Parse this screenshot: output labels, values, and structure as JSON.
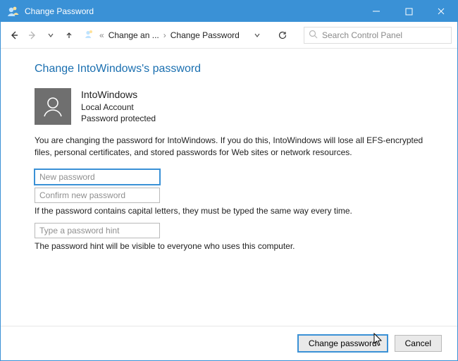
{
  "window": {
    "title": "Change Password"
  },
  "breadcrumb": {
    "seg1": "Change an ...",
    "seg2": "Change Password"
  },
  "search": {
    "placeholder": "Search Control Panel"
  },
  "heading": "Change IntoWindows's password",
  "account": {
    "name": "IntoWindows",
    "type": "Local Account",
    "status": "Password protected"
  },
  "warning": "You are changing the password for IntoWindows.  If you do this, IntoWindows will lose all EFS-encrypted files, personal certificates, and stored passwords for Web sites or network resources.",
  "fields": {
    "new_pw_placeholder": "New password",
    "confirm_pw_placeholder": "Confirm new password",
    "caps_helper": "If the password contains capital letters, they must be typed the same way every time.",
    "hint_placeholder": "Type a password hint",
    "hint_helper": "The password hint will be visible to everyone who uses this computer."
  },
  "buttons": {
    "change": "Change password",
    "cancel": "Cancel"
  },
  "icons": {
    "app": "user-accounts-icon",
    "back": "back-arrow-icon",
    "forward": "forward-arrow-icon",
    "recent_chevron": "chevron-down-icon",
    "up": "up-arrow-icon",
    "addr_chevron": "chevron-down-icon",
    "refresh": "refresh-icon",
    "search": "search-icon",
    "avatar": "person-icon",
    "minimize": "minimize-icon",
    "maximize": "maximize-icon",
    "close": "close-icon"
  }
}
